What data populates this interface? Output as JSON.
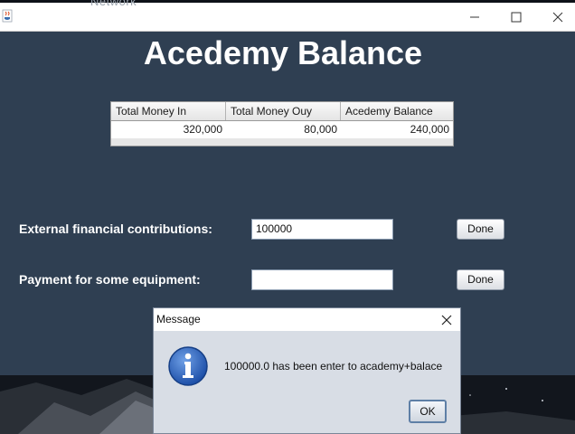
{
  "background_window": {
    "peek_text": "Network"
  },
  "window": {
    "app_icon": "java-cup-icon",
    "controls": [
      "minimize",
      "maximize",
      "close"
    ]
  },
  "main": {
    "title": "Acedemy Balance",
    "table": {
      "headers": [
        "Total Money In",
        "Total Money Ouy",
        "Acedemy Balance"
      ],
      "rows": [
        [
          "320,000",
          "80,000",
          "240,000"
        ]
      ]
    },
    "contribution": {
      "label": "External financial contributions:",
      "value": "100000",
      "button": "Done"
    },
    "payment": {
      "label": "Payment for some equipment:",
      "value": "",
      "button": "Done"
    }
  },
  "dialog": {
    "title": "Message",
    "icon": "info-icon",
    "message": "100000.0 has been enter to academy+balace",
    "ok_label": "OK"
  },
  "colors": {
    "frame_bg": "#2f3f52",
    "dialog_bg": "#d8dde5",
    "title_text": "#ffffff"
  }
}
